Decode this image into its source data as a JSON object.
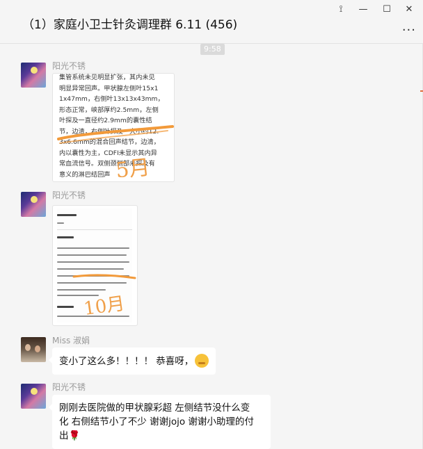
{
  "window": {
    "title": "（1）家庭小卫士针灸调理群 6.11 (456)",
    "controls": {
      "pin": "⟟",
      "minimize": "—",
      "maximize": "☐",
      "close": "✕",
      "more": "..."
    }
  },
  "chat": {
    "timestamp": "9:58",
    "messages": [
      {
        "sender": "阳光不锈",
        "type": "image",
        "image_text": "集管系统未见明显扩张，其内未见\n明显异常回声。甲状腺左侧叶15x1\n1x47mm，右侧叶13x13x43mm，\n形态正常，峡部厚约2.5mm，左侧\n叶探及一直径约2.9mm的囊性结\n节，边清，右侧叶探及一大小约12.\n3x6.6mm的混合回声结节，边清，\n内以囊性为主，CDFI未显示其内异\n常血流信号。双侧颈侧部未探及有\n意义的淋巴结回声",
        "handwritten": "5月"
      },
      {
        "sender": "阳光不锈",
        "type": "image",
        "handwritten": "10月"
      },
      {
        "sender": "Miss 淑娟",
        "type": "text",
        "text": "变小了这么多！！！！ 恭喜呀，",
        "emoji": "shy-face"
      },
      {
        "sender": "阳光不锈",
        "type": "text",
        "lines": [
          "刚刚去医院做的甲状腺彩超  左侧结节没什么变",
          "化 右侧结节小了不少  谢谢jojo 谢谢小助理的付",
          "出"
        ],
        "emoji": "🌹"
      }
    ]
  }
}
